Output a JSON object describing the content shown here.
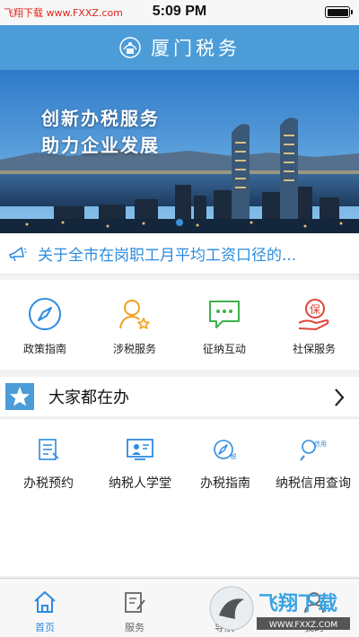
{
  "status_bar": {
    "carrier": "飞翔下载 www.FXXZ.com",
    "time": "5:09 PM"
  },
  "header": {
    "title": "厦门税务"
  },
  "banner": {
    "line1": "创新办税服务",
    "line2": "助力企业发展"
  },
  "notice": {
    "text": "关于全市在岗职工月平均工资口径的..."
  },
  "services": [
    {
      "label": "政策指南",
      "icon": "compass-icon",
      "color": "#2d8be0"
    },
    {
      "label": "涉税服务",
      "icon": "person-star-icon",
      "color": "#f0a020"
    },
    {
      "label": "征纳互动",
      "icon": "chat-bubble-icon",
      "color": "#3fb04a"
    },
    {
      "label": "社保服务",
      "icon": "hand-baby-icon",
      "color": "#e0443a"
    }
  ],
  "section": {
    "title": "大家都在办"
  },
  "quick_items": [
    {
      "label": "办税预约",
      "icon": "appointment-icon"
    },
    {
      "label": "纳税人学堂",
      "icon": "classroom-icon"
    },
    {
      "label": "办税指南",
      "icon": "guide-compass-icon"
    },
    {
      "label": "纳税信用查询",
      "icon": "credit-search-icon"
    }
  ],
  "tabbar": {
    "tabs": [
      {
        "label": "首页",
        "icon": "home-icon",
        "active": true
      },
      {
        "label": "服务",
        "icon": "service-edit-icon",
        "active": false
      },
      {
        "label": "导航",
        "icon": "navigation-icon",
        "active": false
      },
      {
        "label": "我的",
        "icon": "profile-icon",
        "active": false
      }
    ]
  },
  "watermark": {
    "brand": "飞翔下载",
    "url": "WWW.FXXZ.COM"
  },
  "colors": {
    "header": "#4c9cd8",
    "accent": "#2d8be0",
    "page_bg": "#f2f2f2"
  }
}
